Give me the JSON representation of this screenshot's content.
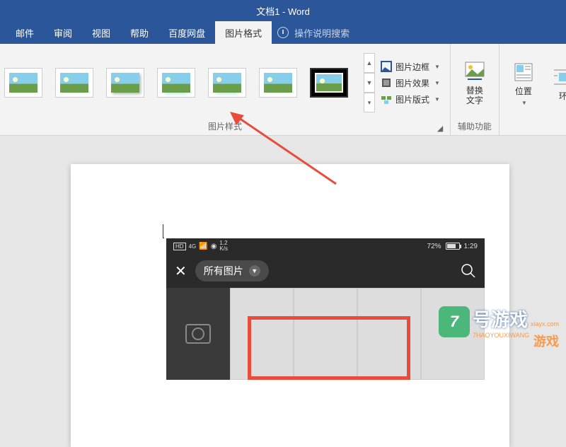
{
  "titlebar": {
    "title": "文档1 - Word"
  },
  "tabs": {
    "items": [
      "邮件",
      "审阅",
      "视图",
      "帮助",
      "百度网盘",
      "图片格式"
    ],
    "active_index": 5,
    "tell_me": "操作说明搜索"
  },
  "ribbon": {
    "styles_group_label": "图片样式",
    "pic_border": "图片边框",
    "pic_effects": "图片效果",
    "pic_layout": "图片版式",
    "alt_text": "替换\n文字",
    "alt_group_label": "辅助功能",
    "position": "位置",
    "wrap": "环"
  },
  "phone": {
    "status_left": "HD",
    "signal": "4G",
    "speed": "1.2",
    "speed_unit": "K/s",
    "battery": "72%",
    "time": "1:29",
    "dropdown": "所有图片"
  },
  "watermark": {
    "badge": "7",
    "main": "号游戏",
    "sub": "7HAOYOUXIWANG",
    "url": "xiayx.com",
    "tag": "游戏"
  }
}
